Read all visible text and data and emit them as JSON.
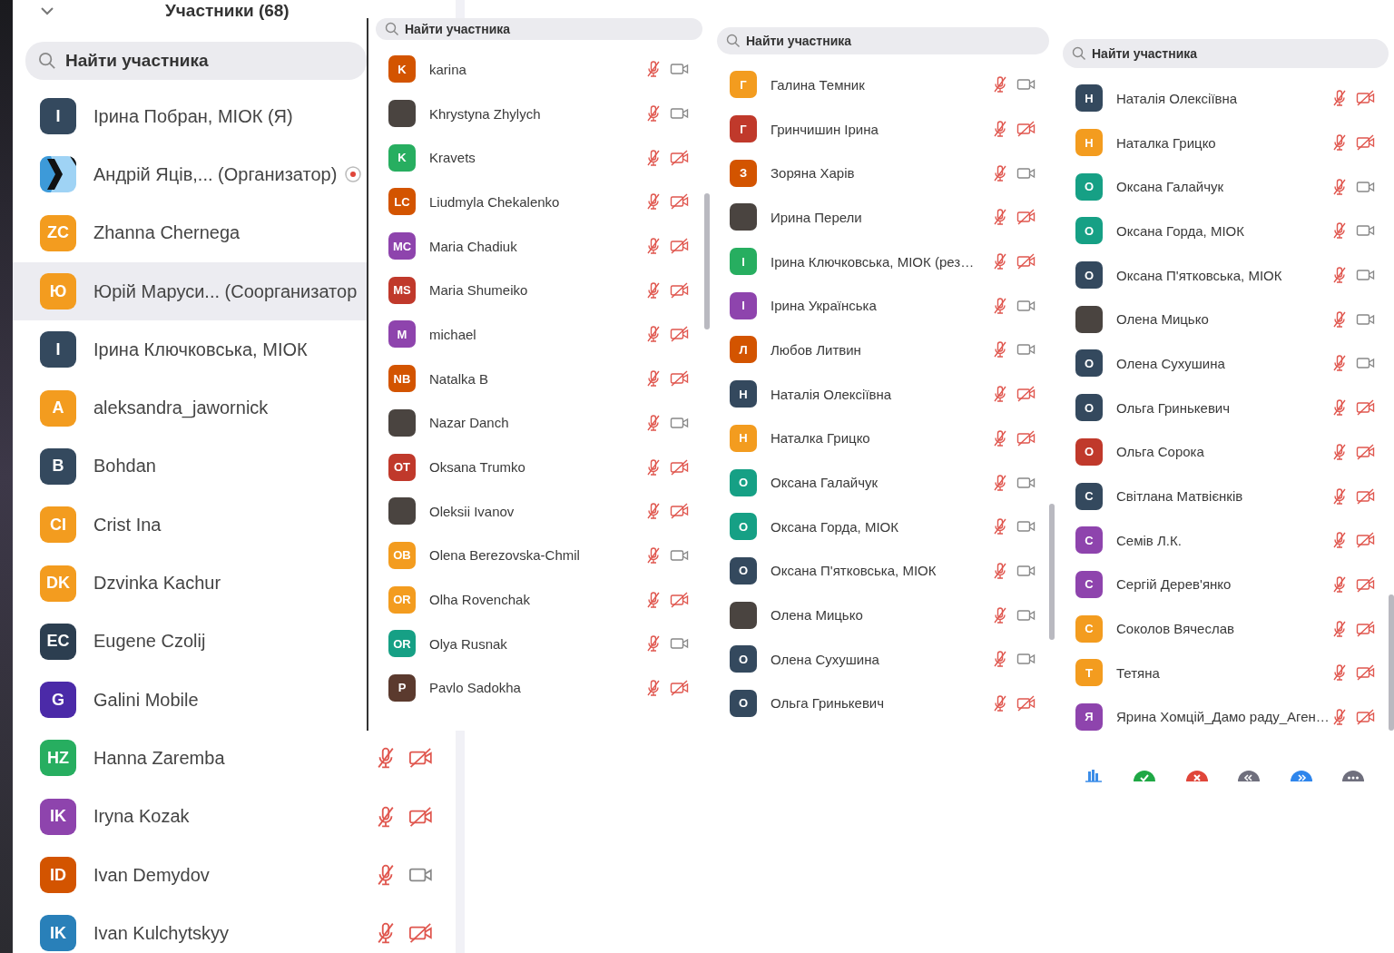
{
  "panels": [
    {
      "title": "Участники (68)",
      "search": {
        "placeholder": "Найти участника"
      },
      "participants": [
        {
          "kind": "initials",
          "initials": "І",
          "color": "#34495e",
          "name": "Ірина Побран, МІОК (Я)",
          "selected": false
        },
        {
          "kind": "logo",
          "name": "Андрій Яців,... (Организатор)",
          "recording": true,
          "selected": false
        },
        {
          "kind": "initials",
          "initials": "ZC",
          "color": "#f39c1f",
          "name": "Zhanna Chernega",
          "selected": false
        },
        {
          "kind": "initials",
          "initials": "Ю",
          "color": "#f39c1f",
          "name": "Юрій Маруси... (Соорганизатор",
          "selected": true
        },
        {
          "kind": "initials",
          "initials": "І",
          "color": "#34495e",
          "name": "Ірина Ключковська, МІОК",
          "selected": false
        },
        {
          "kind": "initials",
          "initials": "A",
          "color": "#f39c1f",
          "name": "aleksandra_jawornick",
          "selected": false
        },
        {
          "kind": "initials",
          "initials": "B",
          "color": "#34495e",
          "name": "Bohdan",
          "selected": false
        },
        {
          "kind": "initials",
          "initials": "CI",
          "color": "#f39c1f",
          "name": "Crist Ina",
          "selected": false
        },
        {
          "kind": "initials",
          "initials": "DK",
          "color": "#f39c1f",
          "name": "Dzvinka Kachur",
          "selected": false
        },
        {
          "kind": "initials",
          "initials": "EC",
          "color": "#2c3e50",
          "name": "Eugene Czolij",
          "selected": false
        },
        {
          "kind": "initials",
          "initials": "G",
          "color": "#4b2aa8",
          "name": "Galini Mobile",
          "selected": false
        },
        {
          "kind": "initials",
          "initials": "HZ",
          "color": "#27ae60",
          "name": "Hanna Zaremba",
          "selected": false,
          "mic_muted": true,
          "video_off": true
        },
        {
          "kind": "initials",
          "initials": "IK",
          "color": "#8e44ad",
          "name": "Iryna Kozak",
          "selected": false,
          "mic_muted": true,
          "video_off": true
        },
        {
          "kind": "initials",
          "initials": "ID",
          "color": "#d35400",
          "name": "Ivan Demydov",
          "selected": false,
          "mic_muted": true,
          "video_off": false
        },
        {
          "kind": "initials",
          "initials": "IK",
          "color": "#2980b9",
          "name": "Ivan Kulchytskyy",
          "selected": false,
          "mic_muted": true,
          "video_off": true
        }
      ]
    },
    {
      "search": {
        "placeholder": "Найти участника"
      },
      "participants": [
        {
          "kind": "initials",
          "initials": "K",
          "color": "#d35400",
          "name": "karina",
          "mic_muted": true,
          "video_off": false
        },
        {
          "kind": "photo",
          "name": "Khrystyna Zhylych",
          "mic_muted": true,
          "video_off": false
        },
        {
          "kind": "initials",
          "initials": "K",
          "color": "#27ae60",
          "name": "Kravets",
          "mic_muted": true,
          "video_off": true
        },
        {
          "kind": "initials",
          "initials": "LC",
          "color": "#d35400",
          "name": "Liudmyla Chekalenko",
          "mic_muted": true,
          "video_off": true
        },
        {
          "kind": "initials",
          "initials": "MC",
          "color": "#8e44ad",
          "name": "Maria Chadiuk",
          "mic_muted": true,
          "video_off": true
        },
        {
          "kind": "initials",
          "initials": "MS",
          "color": "#c0392b",
          "name": "Maria Shumeiko",
          "mic_muted": true,
          "video_off": true
        },
        {
          "kind": "initials",
          "initials": "M",
          "color": "#8e44ad",
          "name": "michael",
          "mic_muted": true,
          "video_off": true
        },
        {
          "kind": "initials",
          "initials": "NB",
          "color": "#d35400",
          "name": "Natalka B",
          "mic_muted": true,
          "video_off": true
        },
        {
          "kind": "photo",
          "name": "Nazar Danch",
          "mic_muted": true,
          "video_off": false
        },
        {
          "kind": "initials",
          "initials": "OT",
          "color": "#c0392b",
          "name": "Oksana Trumko",
          "mic_muted": true,
          "video_off": true
        },
        {
          "kind": "photo",
          "name": "Oleksii Ivanov",
          "mic_muted": true,
          "video_off": true
        },
        {
          "kind": "initials",
          "initials": "OB",
          "color": "#f39c1f",
          "name": "Olena Berezovska-Chmil",
          "mic_muted": true,
          "video_off": false
        },
        {
          "kind": "initials",
          "initials": "OR",
          "color": "#f39c1f",
          "name": "Olha Rovenchak",
          "mic_muted": true,
          "video_off": true
        },
        {
          "kind": "initials",
          "initials": "OR",
          "color": "#16a085",
          "name": "Olya Rusnak",
          "mic_muted": true,
          "video_off": false
        },
        {
          "kind": "initials",
          "initials": "P",
          "color": "#5b3a2e",
          "name": "Pavlo Sadokha",
          "mic_muted": true,
          "video_off": true
        }
      ]
    },
    {
      "search": {
        "placeholder": "Найти участника"
      },
      "participants": [
        {
          "kind": "initials",
          "initials": "Г",
          "color": "#f39c1f",
          "name": "Галина Темник",
          "mic_muted": true,
          "video_off": false
        },
        {
          "kind": "initials",
          "initials": "Г",
          "color": "#c0392b",
          "name": "Гринчишин Ірина",
          "mic_muted": true,
          "video_off": true
        },
        {
          "kind": "initials",
          "initials": "З",
          "color": "#d35400",
          "name": "Зоряна Харів",
          "mic_muted": true,
          "video_off": false
        },
        {
          "kind": "photo",
          "name": "Ирина Перели",
          "mic_muted": true,
          "video_off": true
        },
        {
          "kind": "initials",
          "initials": "І",
          "color": "#27ae60",
          "name": "Ірина Ключковська, МІОК (рез…",
          "mic_muted": true,
          "video_off": true
        },
        {
          "kind": "initials",
          "initials": "І",
          "color": "#8e44ad",
          "name": "Ірина Українська",
          "mic_muted": true,
          "video_off": false
        },
        {
          "kind": "initials",
          "initials": "Л",
          "color": "#d35400",
          "name": "Любов Литвин",
          "mic_muted": true,
          "video_off": false
        },
        {
          "kind": "initials",
          "initials": "Н",
          "color": "#34495e",
          "name": "Наталія Олексіївна",
          "mic_muted": true,
          "video_off": true
        },
        {
          "kind": "initials",
          "initials": "Н",
          "color": "#f39c1f",
          "name": "Наталка Грицко",
          "mic_muted": true,
          "video_off": true
        },
        {
          "kind": "initials",
          "initials": "О",
          "color": "#16a085",
          "name": "Оксана Галайчук",
          "mic_muted": true,
          "video_off": false
        },
        {
          "kind": "initials",
          "initials": "О",
          "color": "#16a085",
          "name": "Оксана Горда, МІОК",
          "mic_muted": true,
          "video_off": false
        },
        {
          "kind": "initials",
          "initials": "О",
          "color": "#34495e",
          "name": "Оксана П'ятковська, МІОК",
          "mic_muted": true,
          "video_off": false
        },
        {
          "kind": "photo",
          "name": "Олена Мицько",
          "mic_muted": true,
          "video_off": false
        },
        {
          "kind": "initials",
          "initials": "О",
          "color": "#34495e",
          "name": "Олена Сухушина",
          "mic_muted": true,
          "video_off": false
        },
        {
          "kind": "initials",
          "initials": "О",
          "color": "#34495e",
          "name": "Ольга Гринькевич",
          "mic_muted": true,
          "video_off": true
        }
      ]
    },
    {
      "search": {
        "placeholder": "Найти участника"
      },
      "participants": [
        {
          "kind": "initials",
          "initials": "Н",
          "color": "#34495e",
          "name": "Наталія Олексіївна",
          "mic_muted": true,
          "video_off": true
        },
        {
          "kind": "initials",
          "initials": "Н",
          "color": "#f39c1f",
          "name": "Наталка Грицко",
          "mic_muted": true,
          "video_off": true
        },
        {
          "kind": "initials",
          "initials": "О",
          "color": "#16a085",
          "name": "Оксана Галайчук",
          "mic_muted": true,
          "video_off": false
        },
        {
          "kind": "initials",
          "initials": "О",
          "color": "#16a085",
          "name": "Оксана Горда, МІОК",
          "mic_muted": true,
          "video_off": false
        },
        {
          "kind": "initials",
          "initials": "О",
          "color": "#34495e",
          "name": "Оксана П'ятковська, МІОК",
          "mic_muted": true,
          "video_off": false
        },
        {
          "kind": "photo",
          "name": "Олена Мицько",
          "mic_muted": true,
          "video_off": false
        },
        {
          "kind": "initials",
          "initials": "О",
          "color": "#34495e",
          "name": "Олена Сухушина",
          "mic_muted": true,
          "video_off": false
        },
        {
          "kind": "initials",
          "initials": "О",
          "color": "#34495e",
          "name": "Ольга Гринькевич",
          "mic_muted": true,
          "video_off": true
        },
        {
          "kind": "initials",
          "initials": "О",
          "color": "#c0392b",
          "name": "Ольга Сорока",
          "mic_muted": true,
          "video_off": true
        },
        {
          "kind": "initials",
          "initials": "С",
          "color": "#34495e",
          "name": "Світлана Матвієнків",
          "mic_muted": true,
          "video_off": true
        },
        {
          "kind": "initials",
          "initials": "С",
          "color": "#8e44ad",
          "name": "Семів Л.К.",
          "mic_muted": true,
          "video_off": true
        },
        {
          "kind": "initials",
          "initials": "С",
          "color": "#8e44ad",
          "name": "Сергій Дерев'янко",
          "mic_muted": true,
          "video_off": true
        },
        {
          "kind": "initials",
          "initials": "С",
          "color": "#f39c1f",
          "name": "Соколов Вячеслав",
          "mic_muted": true,
          "video_off": true
        },
        {
          "kind": "initials",
          "initials": "Т",
          "color": "#f39c1f",
          "name": "Тетяна",
          "mic_muted": true,
          "video_off": true
        },
        {
          "kind": "initials",
          "initials": "Я",
          "color": "#8e44ad",
          "name": "Ярина Хомцій_Дамо раду_Аген…",
          "mic_muted": true,
          "video_off": true
        }
      ]
    }
  ]
}
